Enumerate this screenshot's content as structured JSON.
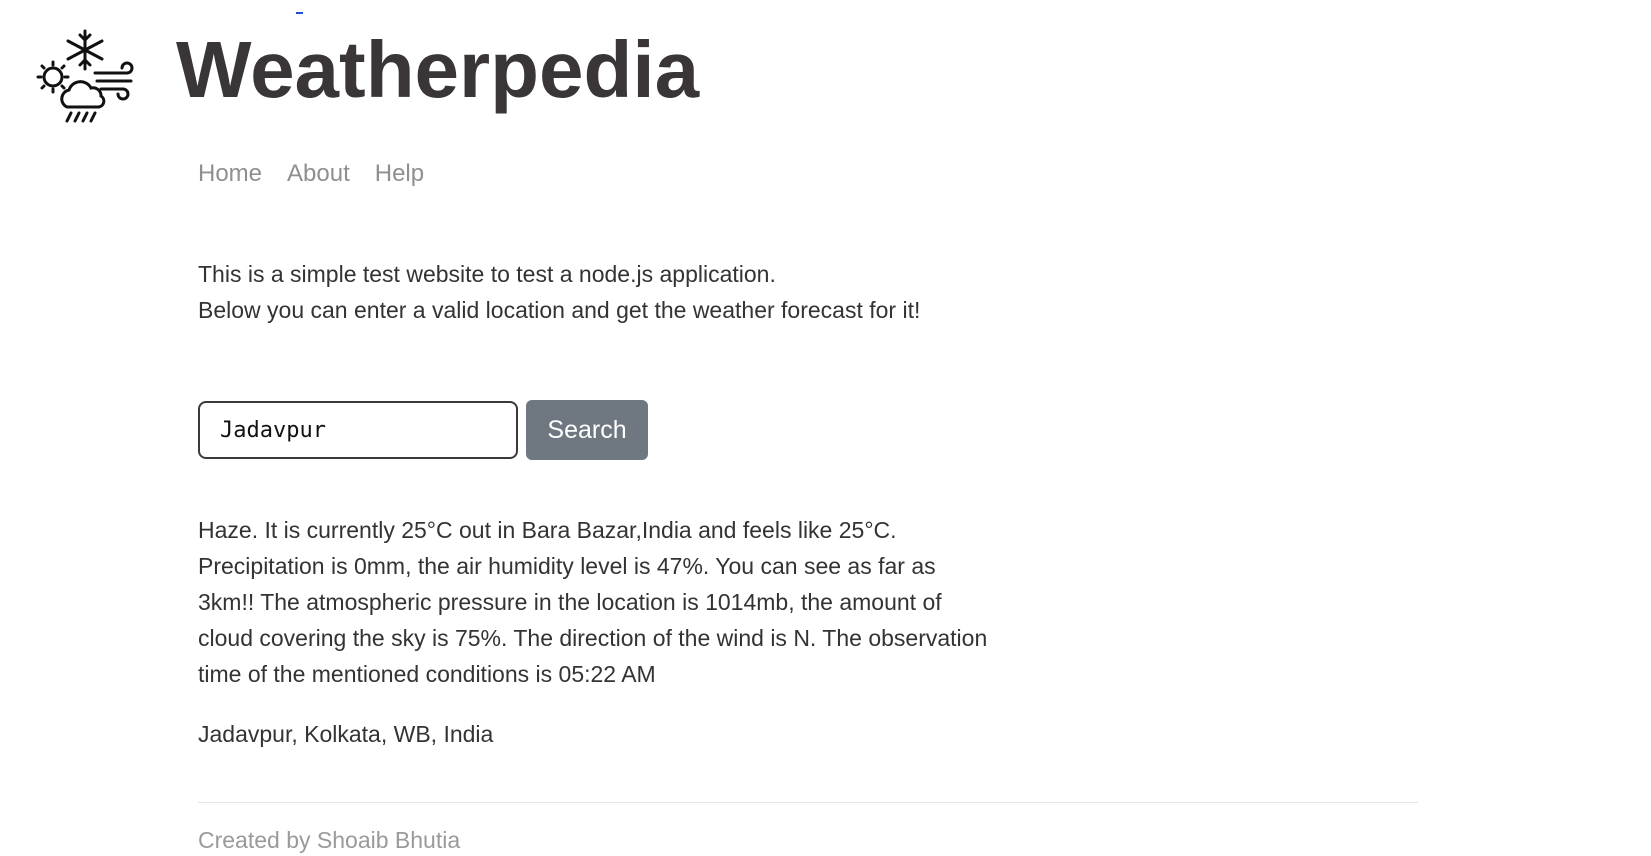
{
  "site": {
    "title": "Weatherpedia",
    "logo_icon": "weather-logo-icon"
  },
  "nav": {
    "items": [
      {
        "label": "Home"
      },
      {
        "label": "About"
      },
      {
        "label": "Help"
      }
    ]
  },
  "intro": {
    "line1": "This is a simple test website to test a node.js application.",
    "line2": "Below you can enter a valid location and get the weather forecast for it!"
  },
  "search": {
    "input_value": "Jadavpur",
    "button_label": "Search"
  },
  "result": {
    "forecast": "Haze. It is currently 25°C out in Bara Bazar,India and feels like 25°C. Precipitation is 0mm, the air humidity level is 47%. You can see as far as 3km!! The atmospheric pressure in the location is 1014mb, the amount of cloud covering the sky is 75%. The direction of the wind is N. The observation time of the mentioned conditions is 05:22 AM",
    "location": "Jadavpur, Kolkata, WB, India"
  },
  "footer": {
    "text": "Created by Shoaib Bhutia"
  },
  "colors": {
    "title": "#3a3536",
    "nav_link": "#8f8f8f",
    "button_bg": "#6f7780",
    "footer_text": "#9a9a9a"
  }
}
